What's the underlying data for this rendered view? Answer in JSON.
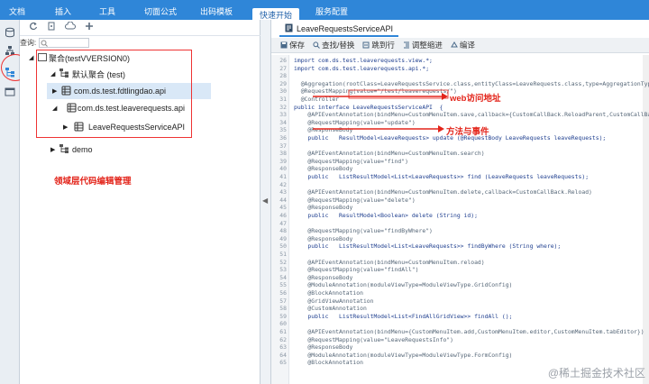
{
  "menu": {
    "items": [
      "文档",
      "插入",
      "工具",
      "切面公式",
      "出码模板",
      "快速开始",
      "服务配置"
    ],
    "active_index": 5
  },
  "left_toolbar": {
    "icons": [
      "refresh-icon",
      "new-file-icon",
      "upload-icon",
      "add-icon"
    ]
  },
  "search": {
    "label": "查询:"
  },
  "tree": {
    "nodes": [
      {
        "label": "聚合(testVVERSION0)",
        "icon": "folder-icon",
        "expanded": true
      },
      {
        "label": "默认聚合 (test)",
        "icon": "module-icon",
        "expanded": true
      },
      {
        "label": "com.ds.test.fdtlingdao.api",
        "icon": "package-icon",
        "expanded": false
      },
      {
        "label": "com.ds.test.leaverequests.api",
        "icon": "package-icon",
        "expanded": true
      },
      {
        "label": "LeaveRequestsServiceAPI",
        "icon": "class-icon",
        "expanded": false
      },
      {
        "label": "demo",
        "icon": "module-icon",
        "expanded": false
      }
    ]
  },
  "annotations": {
    "left": "领域层代码编辑管理",
    "web": "web访问地址",
    "method": "方法与事件"
  },
  "editor": {
    "tab": "LeaveRequestsServiceAPI",
    "toolbar": [
      "保存",
      "查找/替换",
      "跳到行",
      "调整缩进",
      "编译"
    ]
  },
  "code": [
    {
      "n": "26",
      "t": "import com.ds.test.leaverequests.view.*;"
    },
    {
      "n": "27",
      "t": "import com.ds.test.leaverequests.api.*;"
    },
    {
      "n": "28",
      "t": ""
    },
    {
      "n": "29",
      "t": "  @Aggregation(rootClass=LeaveRequestsService.class,entityClass=LeaveRequests.class,type=AggregationType.ag"
    },
    {
      "n": "30",
      "t": "  @RequestMapping(value=\"/test/leaverequests/\")"
    },
    {
      "n": "31",
      "t": "  @Controller"
    },
    {
      "n": "32",
      "t": "public interface LeaveRequestsServiceAPI  {"
    },
    {
      "n": "33",
      "t": "    @APIEventAnnotation(bindMenu=CustomMenuItem.save,callback={CustomCallBack.ReloadParent,CustomCallBack."
    },
    {
      "n": "34",
      "t": "    @RequestMapping(value=\"update\")"
    },
    {
      "n": "35",
      "t": "    @ResponseBody"
    },
    {
      "n": "36",
      "t": "    public   ResultModel<LeaveRequests> update (@RequestBody LeaveRequests leaveRequests);"
    },
    {
      "n": "37",
      "t": ""
    },
    {
      "n": "38",
      "t": "    @APIEventAnnotation(bindMenu=CustomMenuItem.search)"
    },
    {
      "n": "39",
      "t": "    @RequestMapping(value=\"find\")"
    },
    {
      "n": "40",
      "t": "    @ResponseBody"
    },
    {
      "n": "41",
      "t": "    public   ListResultModel<List<LeaveRequests>> find (LeaveRequests leaveRequests);"
    },
    {
      "n": "42",
      "t": ""
    },
    {
      "n": "43",
      "t": "    @APIEventAnnotation(bindMenu=CustomMenuItem.delete,callback=CustomCallBack.Reload)"
    },
    {
      "n": "44",
      "t": "    @RequestMapping(value=\"delete\")"
    },
    {
      "n": "45",
      "t": "    @ResponseBody"
    },
    {
      "n": "46",
      "t": "    public   ResultModel<Boolean> delete (String id);"
    },
    {
      "n": "47",
      "t": ""
    },
    {
      "n": "48",
      "t": "    @RequestMapping(value=\"findByWhere\")"
    },
    {
      "n": "49",
      "t": "    @ResponseBody"
    },
    {
      "n": "50",
      "t": "    public   ListResultModel<List<LeaveRequests>> findByWhere (String where);"
    },
    {
      "n": "51",
      "t": ""
    },
    {
      "n": "52",
      "t": "    @APIEventAnnotation(bindMenu=CustomMenuItem.reload)"
    },
    {
      "n": "53",
      "t": "    @RequestMapping(value=\"findAll\")"
    },
    {
      "n": "54",
      "t": "    @ResponseBody"
    },
    {
      "n": "55",
      "t": "    @ModuleAnnotation(moduleViewType=ModuleViewType.GridConfig)"
    },
    {
      "n": "56",
      "t": "    @BlockAnnotation"
    },
    {
      "n": "57",
      "t": "    @GridViewAnnotation"
    },
    {
      "n": "58",
      "t": "    @CustomAnnotation"
    },
    {
      "n": "59",
      "t": "    public   ListResultModel<List<FindAllGridView>> findAll ();"
    },
    {
      "n": "60",
      "t": ""
    },
    {
      "n": "61",
      "t": "    @APIEventAnnotation(bindMenu={CustomMenuItem.add,CustomMenuItem.editor,CustomMenuItem.tabEditor})"
    },
    {
      "n": "62",
      "t": "    @RequestMapping(value=\"LeaveRequestsInfo\")"
    },
    {
      "n": "63",
      "t": "    @ResponseBody"
    },
    {
      "n": "64",
      "t": "    @ModuleAnnotation(moduleViewType=ModuleViewType.FormConfig)"
    },
    {
      "n": "65",
      "t": "    @BlockAnnotation"
    }
  ],
  "watermark": "@稀土掘金技术社区",
  "colors": {
    "accent": "#2f86d8",
    "annotation": "#e3241a"
  }
}
